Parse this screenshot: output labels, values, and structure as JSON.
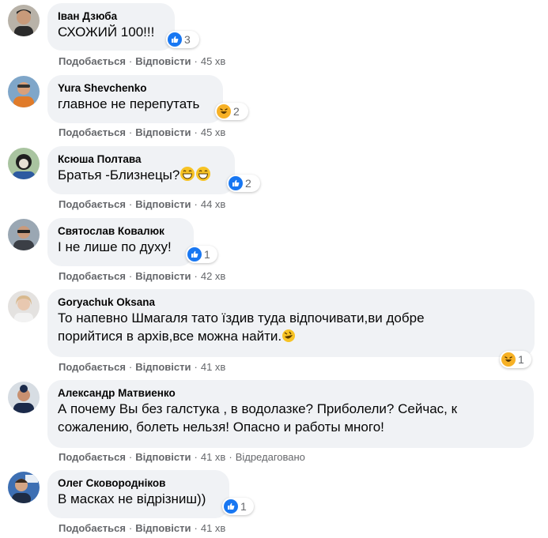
{
  "actions": {
    "like": "Подобається",
    "reply": "Відповісти",
    "dot": "·"
  },
  "colors": {
    "bubble": "#f0f2f5",
    "meta": "#65676b",
    "like_blue": "#1877f2",
    "haha_yellow": "#f7b125"
  },
  "comments": [
    {
      "author": "Іван Дзюба",
      "text": "СХОЖИЙ 100!!!",
      "reaction": "like-icon",
      "count": "3",
      "time": "45 хв"
    },
    {
      "author": "Yura Shevchenko",
      "text": "главное не перепутать",
      "reaction": "haha-icon",
      "count": "2",
      "time": "45 хв"
    },
    {
      "author": "Ксюша Полтава",
      "text": "Братья -Близнецы?",
      "reaction": "like-icon",
      "count": "2",
      "time": "44 хв"
    },
    {
      "author": "Святослав Ковалюк",
      "text": "І не лише по духу!",
      "reaction": "like-icon",
      "count": "1",
      "time": "42 хв"
    },
    {
      "author": "Goryachuk Oksana",
      "text": "То напевно Шмагаля тато їздив туда відпочивати,ви добре порийтися в архів,все можна найти.",
      "reaction": "haha-icon",
      "count": "1",
      "time": "41 хв"
    },
    {
      "author": "Александр Матвиенко",
      "text": "А почему Вы без галстука , в водолазке? Приболели? Сейчас, к сожалению, болеть нельзя! Опасно и работы много!",
      "time": "41 хв",
      "edited": "Відредаговано"
    },
    {
      "author": "Олег Сковородніков",
      "text": "В масках не відрізниш))",
      "reaction": "like-icon",
      "count": "1",
      "time": "41 хв"
    }
  ]
}
